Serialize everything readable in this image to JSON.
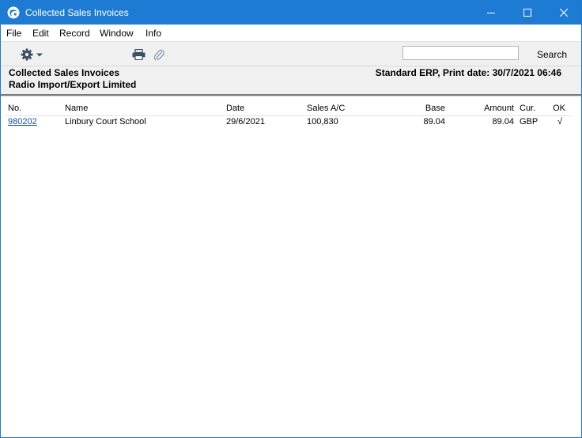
{
  "window": {
    "title": "Collected Sales Invoices"
  },
  "menu": {
    "items": [
      "File",
      "Edit",
      "Record",
      "Window",
      "Info"
    ]
  },
  "toolbar": {
    "search_value": "",
    "search_label": "Search"
  },
  "report": {
    "title": "Collected Sales Invoices",
    "company": "Radio Import/Export Limited",
    "system_print": "Standard ERP, Print date: 30/7/2021 06:46"
  },
  "table": {
    "headers": {
      "no": "No.",
      "name": "Name",
      "date": "Date",
      "sales_ac": "Sales A/C",
      "base": "Base",
      "amount": "Amount",
      "cur": "Cur.",
      "ok": "OK"
    },
    "rows": [
      {
        "no": "980202",
        "name": "Linbury Court School",
        "date": "29/6/2021",
        "sales_ac": "100,830",
        "base": "89.04",
        "amount": "89.04",
        "cur": "GBP",
        "ok": "√"
      }
    ]
  },
  "colors": {
    "titlebar": "#1e7bd3",
    "toolbar_bg": "#f0f0f0",
    "link": "#1a4fa3"
  }
}
